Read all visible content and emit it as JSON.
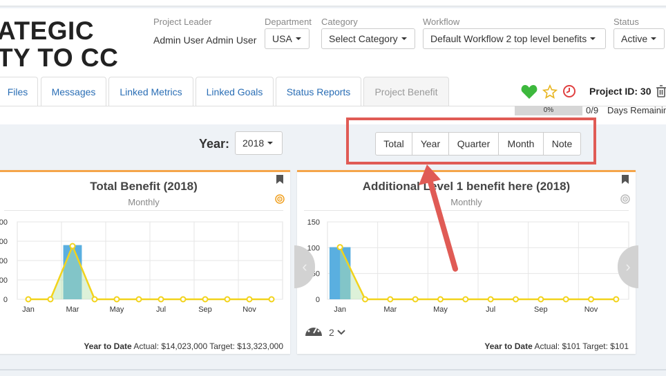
{
  "header": {
    "title_line1": "ATEGIC",
    "title_line2": "TY TO CC",
    "project_leader_label": "Project Leader",
    "project_leader_value": "Admin User Admin User",
    "department_label": "Department",
    "department_value": "USA",
    "category_label": "Category",
    "category_value": "Select Category",
    "workflow_label": "Workflow",
    "workflow_value": "Default Workflow 2 top level benefits",
    "status_label": "Status",
    "status_value": "Active"
  },
  "tabs": [
    {
      "label": "Files"
    },
    {
      "label": "Messages"
    },
    {
      "label": "Linked Metrics"
    },
    {
      "label": "Linked Goals"
    },
    {
      "label": "Status Reports"
    },
    {
      "label": "Project Benefit"
    }
  ],
  "project": {
    "id_text": "Project ID: 30",
    "progress_text": "0%",
    "progress_value": 0,
    "fraction_text": "0/9",
    "days_text": "Days Remaining"
  },
  "toolbar": {
    "year_label": "Year:",
    "year_value": "2018",
    "view_buttons": [
      "Total",
      "Year",
      "Quarter",
      "Month",
      "Note"
    ]
  },
  "colors": {
    "accent_orange": "#f5a54a",
    "bar_blue": "#5aafe0",
    "line_yellow": "#f2d31b",
    "callout_red": "#e05b55",
    "heart_green": "#3db83d",
    "star_yellow": "#e8b623",
    "clock_red": "#e04040"
  },
  "cards": [
    {
      "title": "Total Benefit (2018)",
      "subtitle": "Monthly",
      "ytd_label": "Year to Date",
      "ytd_rest": "Actual: $14,023,000 Target: $13,323,000"
    },
    {
      "title": "Additional Level 1 benefit here (2018)",
      "subtitle": "Monthly",
      "ytd_label": "Year to Date",
      "ytd_rest": "Actual: $101 Target: $101",
      "gauge_count": "2"
    }
  ],
  "chart_data": [
    {
      "type": "bar",
      "title": "",
      "categories": [
        "Jan",
        "Feb",
        "Mar",
        "Apr",
        "May",
        "Jun",
        "Jul",
        "Aug",
        "Sep",
        "Oct",
        "Nov",
        "Dec"
      ],
      "x_tick_labels": [
        "Jan",
        "Mar",
        "May",
        "Jul",
        "Sep",
        "Nov"
      ],
      "y_tick_labels": [
        "0",
        "00",
        "00",
        "00",
        "00"
      ],
      "ylim": [
        0,
        4
      ],
      "series": [
        {
          "kind": "bar",
          "values": [
            0,
            0,
            2.8,
            0,
            0,
            0,
            0,
            0,
            0,
            0,
            0,
            0
          ]
        },
        {
          "kind": "line",
          "values": [
            0,
            0,
            2.75,
            0,
            0,
            0,
            0,
            0,
            0,
            0,
            0,
            0
          ]
        }
      ]
    },
    {
      "type": "bar",
      "title": "",
      "categories": [
        "Jan",
        "Feb",
        "Mar",
        "Apr",
        "May",
        "Jun",
        "Jul",
        "Aug",
        "Sep",
        "Oct",
        "Nov",
        "Dec"
      ],
      "x_tick_labels": [
        "Jan",
        "Mar",
        "May",
        "Jul",
        "Sep",
        "Nov"
      ],
      "y_tick_labels": [
        "0",
        "50",
        "100",
        "150"
      ],
      "ylim": [
        0,
        150
      ],
      "series": [
        {
          "kind": "bar",
          "values": [
            101,
            0,
            0,
            0,
            0,
            0,
            0,
            0,
            0,
            0,
            0,
            0
          ]
        },
        {
          "kind": "line",
          "values": [
            101,
            0,
            0,
            0,
            0,
            0,
            0,
            0,
            0,
            0,
            0,
            0
          ]
        }
      ]
    }
  ]
}
